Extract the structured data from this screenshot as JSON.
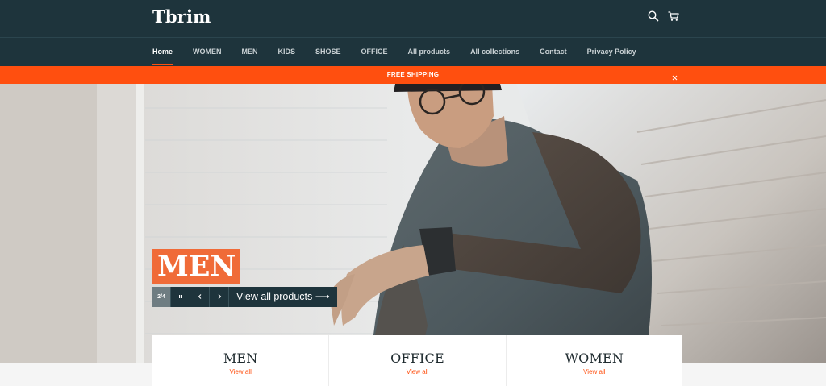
{
  "header": {
    "logo": "Tbrim",
    "icons": {
      "search": "search-icon",
      "cart": "cart-icon"
    }
  },
  "nav": {
    "items": [
      {
        "label": "Home",
        "active": true
      },
      {
        "label": "WOMEN"
      },
      {
        "label": "MEN"
      },
      {
        "label": "KIDS"
      },
      {
        "label": "SHOSE"
      },
      {
        "label": "OFFICE"
      },
      {
        "label": "All products"
      },
      {
        "label": "All collections"
      },
      {
        "label": "Contact"
      },
      {
        "label": "Privacy Policy"
      }
    ]
  },
  "announcement": {
    "text": "FREE SHIPPING",
    "close_icon": "close-icon"
  },
  "hero": {
    "title": "MEN",
    "slide_counter": "2/4",
    "pause_icon": "pause-icon",
    "prev_icon": "chevron-left-icon",
    "next_icon": "chevron-right-icon",
    "cta_label": "View all products ⟶"
  },
  "collections": [
    {
      "title": "MEN",
      "link": "View all"
    },
    {
      "title": "OFFICE",
      "link": "View all"
    },
    {
      "title": "WOMEN",
      "link": "View all"
    }
  ],
  "colors": {
    "header_bg": "#1e343c",
    "accent": "#ff4f0f",
    "hero_title_bg": "#f06b38",
    "page_bg": "#f5f5f5"
  }
}
